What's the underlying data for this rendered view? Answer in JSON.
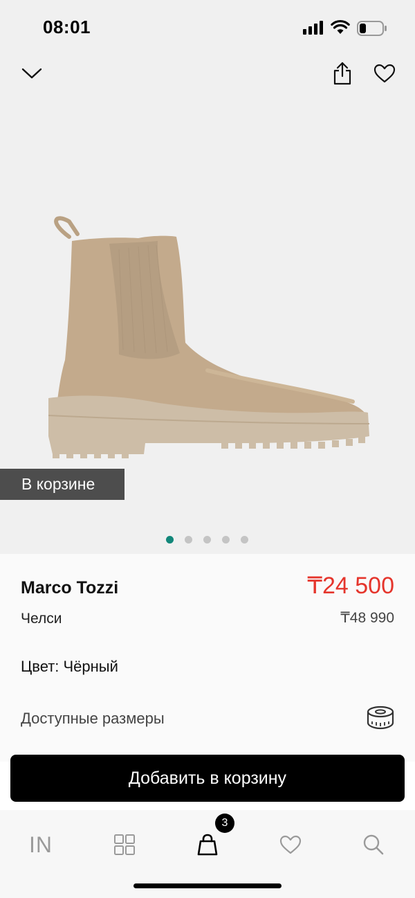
{
  "status_bar": {
    "time": "08:01"
  },
  "product": {
    "in_cart_label": "В корзине",
    "brand": "Marco Tozzi",
    "category": "Челси",
    "price": "₸24 500",
    "old_price": "₸48 990",
    "color_label": "Цвет: Чёрный",
    "sizes_label": "Доступные размеры",
    "image_count": 5,
    "active_image_index": 0
  },
  "actions": {
    "add_to_cart": "Добавить в корзину"
  },
  "bottom_nav": {
    "home_label": "IN",
    "cart_count": "3",
    "items": [
      "home-icon",
      "catalog-grid-icon",
      "cart-bag-icon",
      "heart-icon",
      "search-icon"
    ]
  },
  "colors": {
    "accent": "#12877a",
    "price": "#e5352c",
    "cta": "#000000"
  }
}
